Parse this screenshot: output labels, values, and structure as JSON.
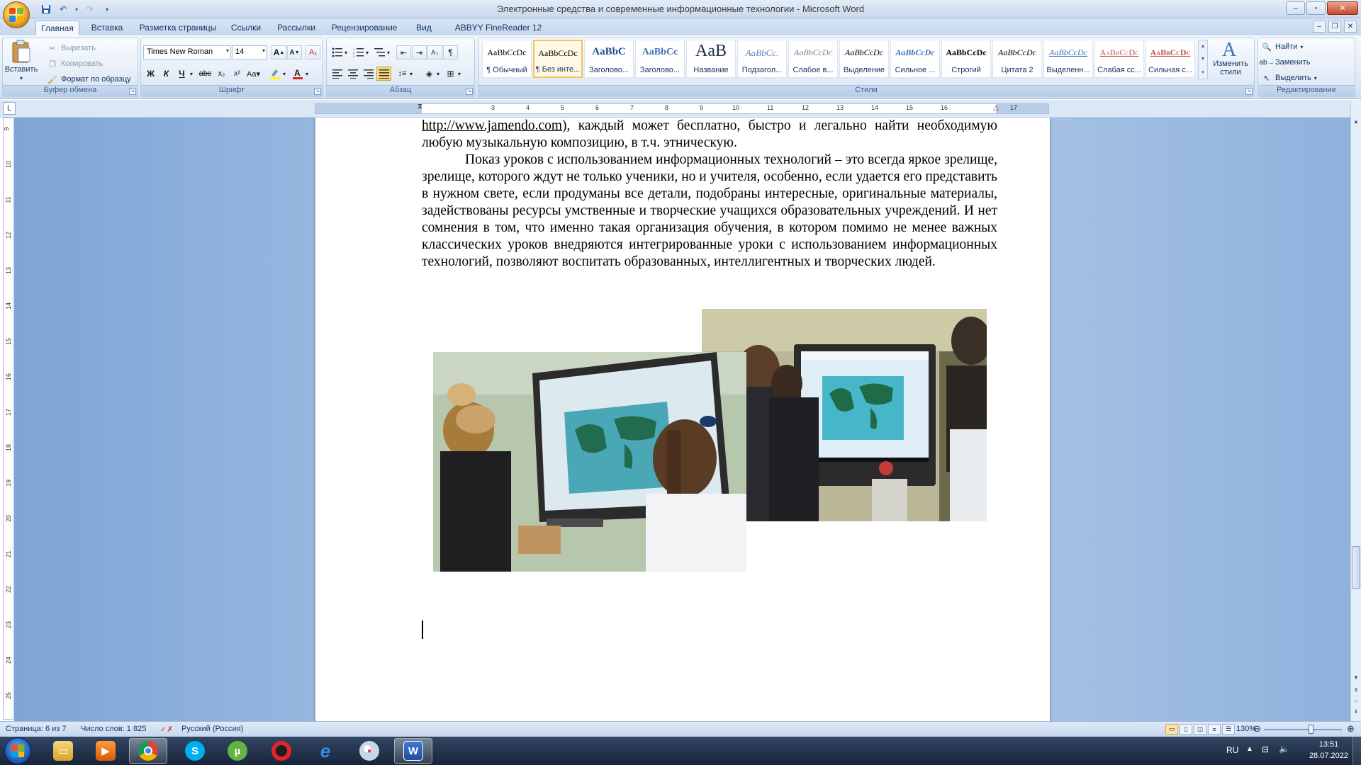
{
  "window": {
    "title": "Электронные средства и современные информационные технологии - Microsoft Word",
    "minimize": "–",
    "maximize": "▫",
    "close": "✕"
  },
  "tabs": [
    "Главная",
    "Вставка",
    "Разметка страницы",
    "Ссылки",
    "Рассылки",
    "Рецензирование",
    "Вид",
    "ABBYY FineReader 12"
  ],
  "ribbon": {
    "clipboard": {
      "label": "Буфер обмена",
      "paste": "Вставить",
      "cut": "Вырезать",
      "copy": "Копировать",
      "format_painter": "Формат по образцу"
    },
    "font": {
      "label": "Шрифт",
      "font_name": "Times New Roman",
      "font_size": "14"
    },
    "paragraph": {
      "label": "Абзац"
    },
    "styles": {
      "label": "Стили",
      "items": [
        {
          "preview": "AaBbCcDc",
          "name": "¶ Обычный"
        },
        {
          "preview": "AaBbCcDc",
          "name": "¶ Без инте..."
        },
        {
          "preview": "AaBbC",
          "name": "Заголово..."
        },
        {
          "preview": "AaBbCc",
          "name": "Заголово..."
        },
        {
          "preview": "AaB",
          "name": "Название"
        },
        {
          "preview": "AaBbCc.",
          "name": "Подзагол..."
        },
        {
          "preview": "AaBbCcDc",
          "name": "Слабое в..."
        },
        {
          "preview": "AaBbCcDc",
          "name": "Выделение"
        },
        {
          "preview": "AaBbCcDc",
          "name": "Сильное ..."
        },
        {
          "preview": "AaBbCcDc",
          "name": "Строгий"
        },
        {
          "preview": "AaBbCcDc",
          "name": "Цитата 2"
        },
        {
          "preview": "AaBbCcDc",
          "name": "Выделенн..."
        },
        {
          "preview": "AaBbCcDc",
          "name": "Слабая сс..."
        },
        {
          "preview": "AaBbCcDc",
          "name": "Сильная с..."
        }
      ],
      "change_styles": "Изменить стили"
    },
    "editing": {
      "label": "Редактирование",
      "find": "Найти",
      "replace": "Заменить",
      "select": "Выделить"
    }
  },
  "document": {
    "link_text": "http://www.jamendo.com",
    "para1_rest": "), каждый может бесплатно, быстро и легально найти необходимую любую музыкальную композицию, в т.ч. этническую.",
    "para2": "Показ уроков с использованием информационных технологий – это всегда яркое зрелище, зрелище, которого ждут не только ученики, но и учителя, особенно, если удается его представить в нужном свете, если продуманы все детали, подобраны интересные, оригинальные материалы, задействованы ресурсы умственные и творческие учащихся образовательных учреждений. И нет сомнения в том, что именно такая организация обучения, в котором помимо не менее важных классических уроков внедряются интегрированные уроки с использованием информационных технологий, позволяют воспитать образованных, интеллигентных и творческих людей."
  },
  "status": {
    "page": "Страница: 6 из 7",
    "words": "Число слов: 1 825",
    "language": "Русский (Россия)",
    "zoom": "130%"
  },
  "taskbar": {
    "lang": "RU",
    "time": "13:51",
    "date": "28.07.2022"
  }
}
